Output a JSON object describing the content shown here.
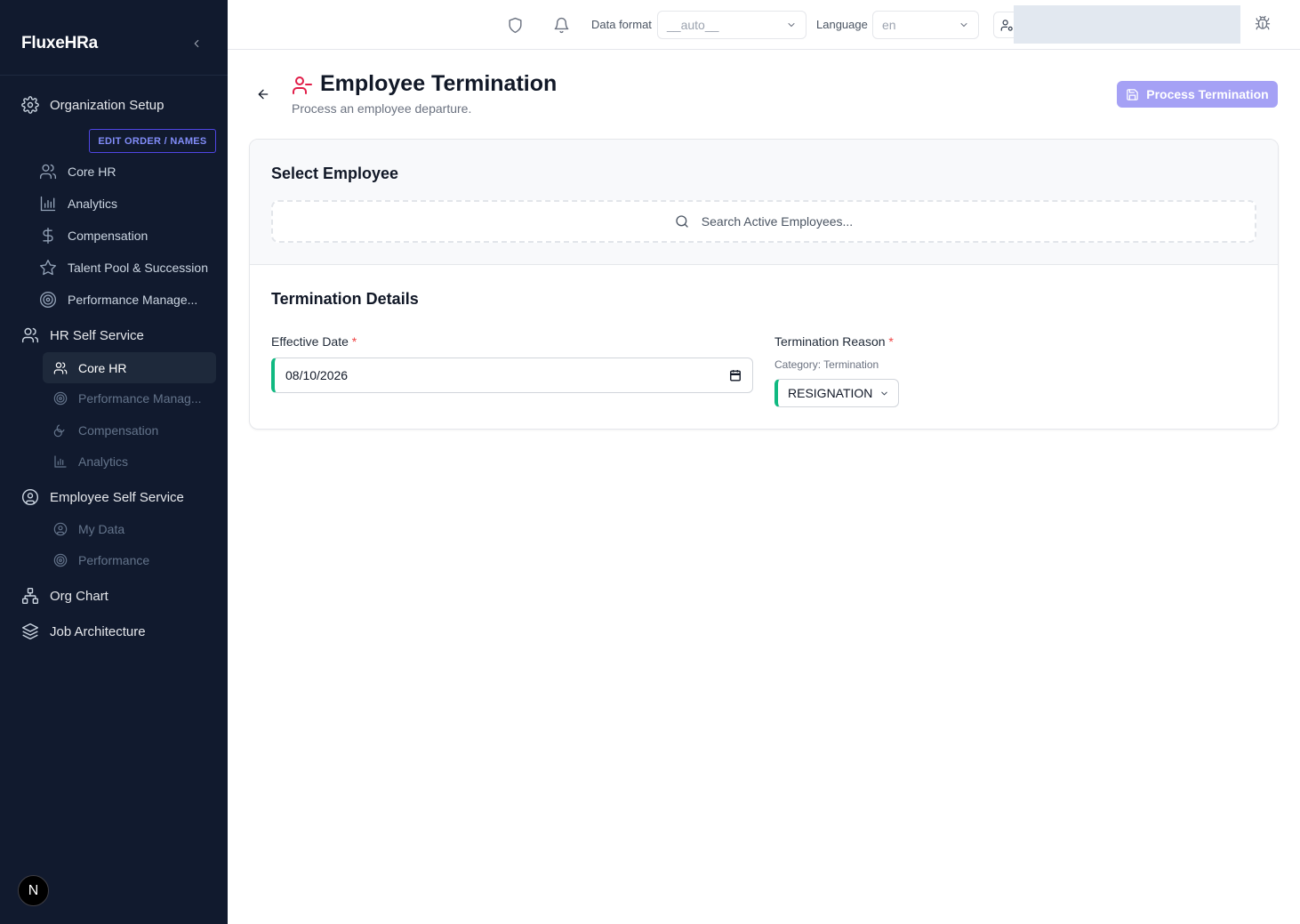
{
  "sidebar": {
    "brand": "FluxeHRa",
    "edit_order_label": "EDIT ORDER / NAMES",
    "org_setup": "Organization Setup",
    "org_items": [
      "Core HR",
      "Analytics",
      "Compensation",
      "Talent Pool & Succession",
      "Performance Manage..."
    ],
    "hr_self_service": "HR Self Service",
    "hr_items": [
      "Core HR",
      "Performance Manag...",
      "Compensation",
      "Analytics"
    ],
    "employee_self_service": "Employee Self Service",
    "ess_items": [
      "My Data",
      "Performance"
    ],
    "org_chart": "Org Chart",
    "job_architecture": "Job Architecture",
    "next_badge": "N"
  },
  "topbar": {
    "data_format_label": "Data format",
    "data_format_value": "__auto__",
    "language_label": "Language",
    "language_value": "en"
  },
  "header": {
    "title": "Employee Termination",
    "subtitle": "Process an employee departure.",
    "process_button": "Process Termination"
  },
  "select_employee": {
    "title": "Select Employee",
    "search_placeholder": "Search Active Employees..."
  },
  "termination_details": {
    "title": "Termination Details",
    "effective_date_label": "Effective Date",
    "effective_date_value": "08/10/2026",
    "reason_label": "Termination Reason",
    "required_mark": "*",
    "category_text": "Category: Termination",
    "reason_value": "RESIGNATION"
  },
  "colors": {
    "sidebar_bg": "#111a2e",
    "accent": "#a5a1f5",
    "required": "#ef4444",
    "valid_border": "#10b981",
    "title_icon": "#e11d48"
  }
}
